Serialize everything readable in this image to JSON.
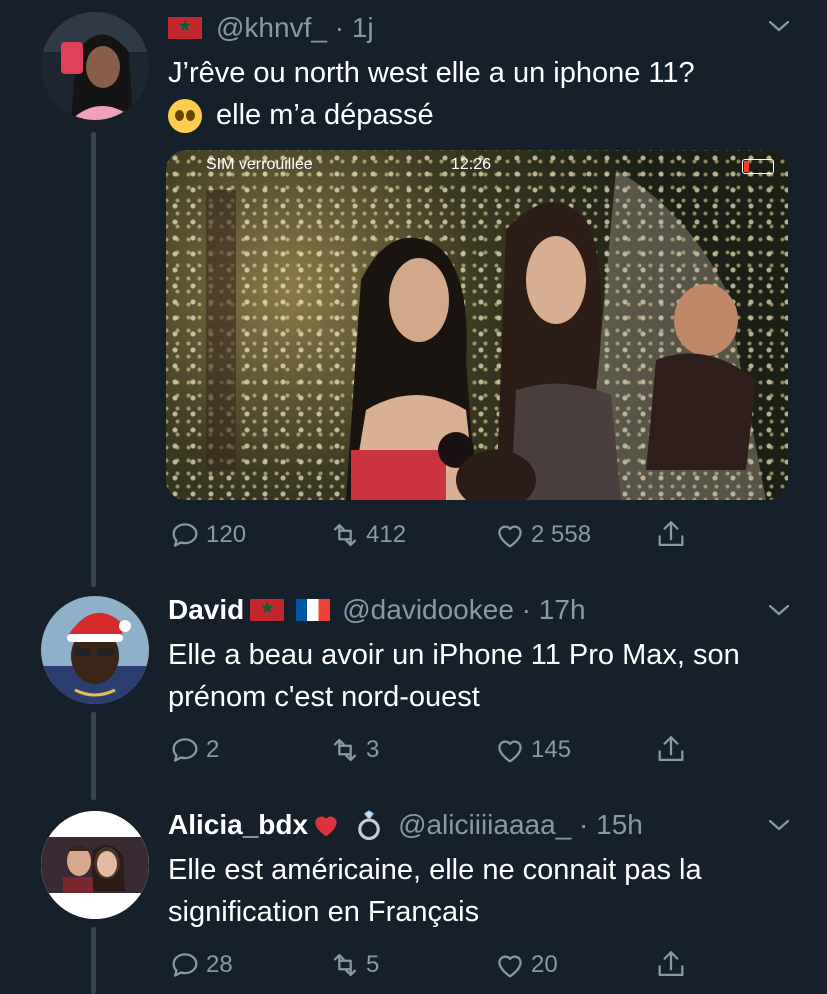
{
  "tweets": [
    {
      "handle": "@khnvf_",
      "sep": " · ",
      "time": "1j",
      "text_line1": "J’rêve ou north west elle a un iphone 11?",
      "text_line2": "elle m’a dépassé",
      "emoji": "pleading-face",
      "image": {
        "status_carrier": "SIM verrouillée",
        "status_time": "12:26"
      },
      "replies": "120",
      "retweets": "412",
      "likes": "2 558"
    },
    {
      "name": "David",
      "handle": "@davidookee",
      "sep": " · ",
      "time": "17h",
      "text": "Elle a beau avoir un iPhone 11 Pro Max, son prénom c'est nord-ouest",
      "replies": "2",
      "retweets": "3",
      "likes": "145"
    },
    {
      "name": "Alicia_bdx",
      "handle": "@aliciiiiaaaa_",
      "sep": " · ",
      "time": "15h",
      "text": "Elle est américaine, elle ne connait pas la signification en Français",
      "replies": "28",
      "retweets": "5",
      "likes": "20"
    }
  ],
  "icons": {
    "reply": "reply-icon",
    "retweet": "retweet-icon",
    "like": "heart-icon",
    "share": "share-icon",
    "menu": "chevron-down-icon"
  },
  "colors": {
    "background": "#15202b",
    "muted": "#8899a6",
    "thread_line": "#38444d"
  }
}
